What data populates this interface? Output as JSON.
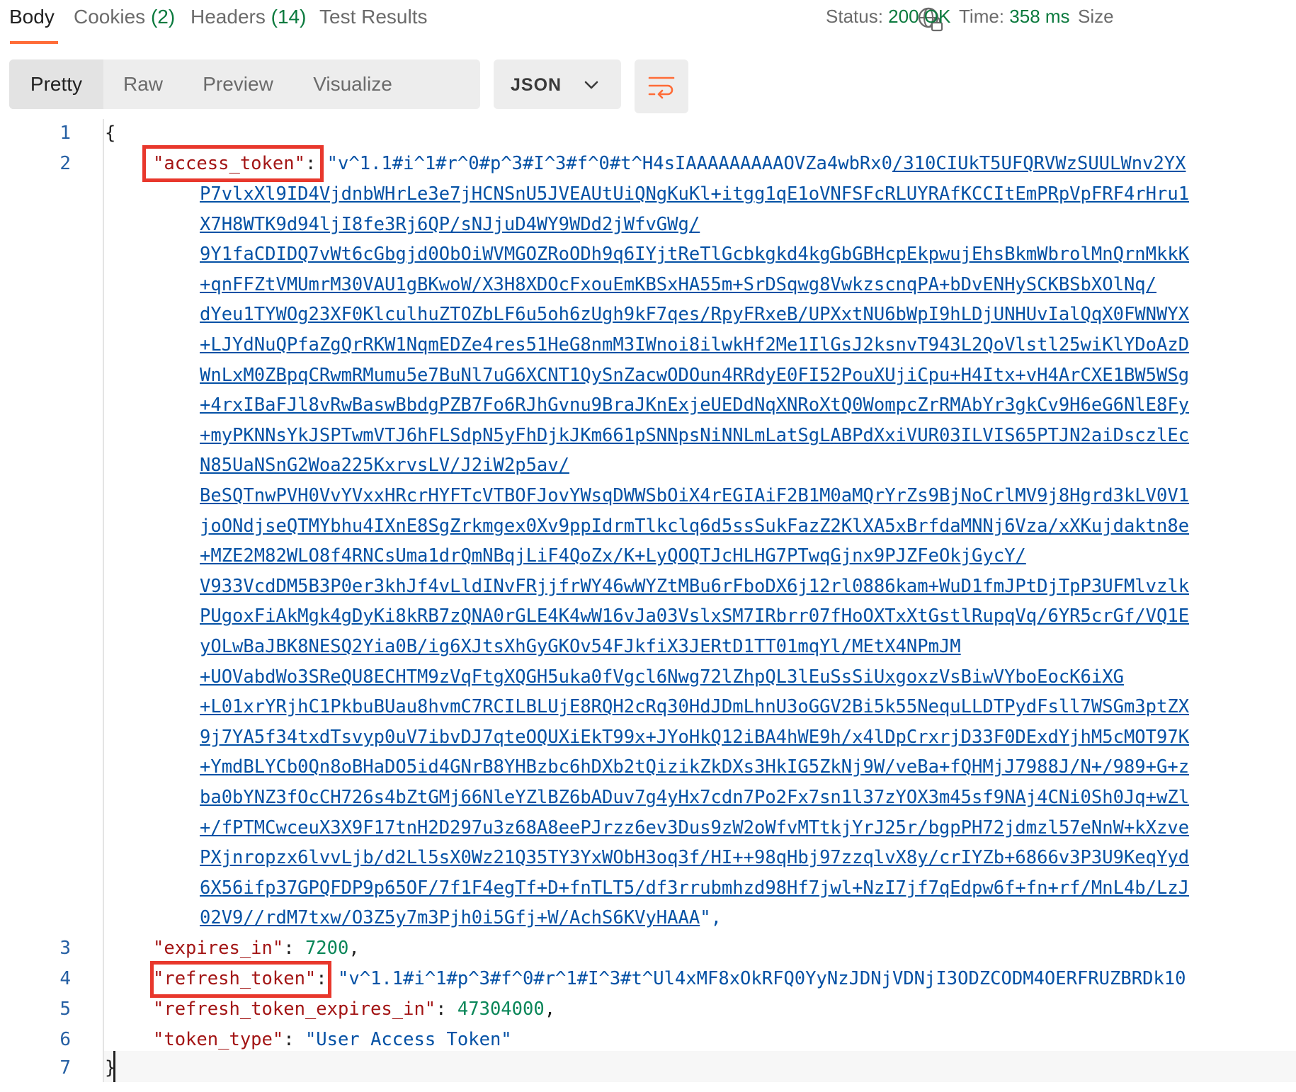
{
  "tabs": [
    {
      "label": "Body",
      "count": ""
    },
    {
      "label": "Cookies ",
      "count": "(2)"
    },
    {
      "label": "Headers ",
      "count": "(14)"
    },
    {
      "label": "Test Results",
      "count": ""
    }
  ],
  "status": {
    "status_label": "Status:",
    "status_value": "200 OK",
    "time_label": "Time:",
    "time_value": "358 ms",
    "size_label": "Size"
  },
  "view_modes": [
    "Pretty",
    "Raw",
    "Preview",
    "Visualize"
  ],
  "format": "JSON",
  "icons": {
    "globe": "globe-lock-icon",
    "wrap": "wrap-lines-icon",
    "chevron": "chevron-down-icon"
  },
  "colors": {
    "accent": "#ff6c37",
    "status_ok": "#0b7a3e",
    "highlight": "#e8372c"
  },
  "editor": {
    "line_numbers": [
      "1",
      "2",
      "3",
      "4",
      "5",
      "6",
      "7"
    ],
    "open_brace": "{",
    "close_brace": "}",
    "access_token_key": "\"access_token\"",
    "access_token_first": "\"v^1.1#i^1#r^0#p^3#I^3#f^0#t^H4sIAAAAAAAAAOVZa4wbRx0",
    "access_token_first_link": "/310CIUkT5UFQRVWzSUULWnv2YX",
    "access_token_cont": [
      "P7vlxXl9ID4VjdnbWHrLe3e7jHCNSnU5JVEAUtUiQNgKuKl+itgg1qE1oVNFSFcRLUYRAfKCCItEmPRpVpFRF4rHru1",
      "X7H8WTK9d94ljI8fe3Rj6QP/sNJjuD4WY9WDd2jWfvGWg/",
      "9Y1faCDIDQ7vWt6cGbgjd0ObOiWVMGOZRoODh9q6IYjtReTlGcbkgkd4kgGbGBHcpEkpwujEhsBkmWbrolMnQrnMkkK",
      "+qnFFZtVMUmrM30VAU1gBKwoW/X3H8XDOcFxouEmKBSxHA55m+SrDSqwg8VwkzscnqPA+bDvENHySCKBSbXOlNq/",
      "dYeu1TYWOg23XF0KlculhuZTOZbLF6u5oh6zUgh9kF7qes/RpyFRxeB/UPXxtNU6bWpI9hLDjUNHUvIalQqX0FWNWYX",
      "+LJYdNuQPfaZgQrRKW1NqmEDZe4res51HeG8nmM3IWnoi8ilwkHf2Me1IlGsJ2ksnvT943L2QoVlstl25wiKlYDoAzD",
      "WnLxM0ZBpqCRwmRMumu5e7BuNl7uG6XCNT1QySnZacwODOun4RRdyE0FI52PouXUjiCpu+H4Itx+vH4ArCXE1BW5WSg",
      "+4rxIBaFJl8vRwBaswBbdgPZB7Fo6RJhGvnu9BraJKnExjeUEDdNqXNRoXtQ0WompcZrRMAbYr3gkCv9H6eG6NlE8Fy",
      "+myPKNNsYkJSPTwmVTJ6hFLSdpN5yFhDjkJKm661pSNNpsNiNNLmLatSgLABPdXxiVUR03ILVIS65PTJN2aiDsczlEc",
      "N85UaNSnG2Woa225KxrvsLV/J2iW2p5av/",
      "BeSQTnwPVH0VvYVxxHRcrHYFTcVTBOFJovYWsqDWWSbOiX4rEGIAiF2B1M0aMQrYrZs9BjNoCrlMV9j8Hgrd3kLV0V1",
      "joONdjseQTMYbhu4IXnE8SgZrkmgex0Xv9ppIdrmTlkclq6d5ssSukFazZ2KlXA5xBrfdaMNNj6Vza/xXKujdaktn8e",
      "+MZE2M82WLO8f4RNCsUma1drQmNBqjLiF4QoZx/K+LyQOQTJcHLHG7PTwqGjnx9PJZFeOkjGycY/",
      "V933VcdDM5B3P0er3khJf4vLldINvFRjjfrWY46wWYZtMBu6rFboDX6j12rl0886kam+WuD1fmJPtDjTpP3UFMlvzlk",
      "PUgoxFiAkMgk4gDyKi8kRB7zQNA0rGLE4K4wW16vJa03VslxSM7IRbrr07fHoOXTxXtGstlRupqVq/6YR5crGf/VQ1E",
      "yOLwBaJBK8NESQ2Yia0B/ig6XJtsXhGyGKOv54FJkfiX3JERtD1TT01mqYl/MEtX4NPmJM",
      "+UOVabdWo3SReQU8ECHTM9zVqFtgXQGH5uka0fVgcl6Nwg72lZhpQL3lEuSsSiUxgoxzVsBiwVYboEocK6iXG",
      "+L01xrYRjhC1PkbuBUau8hvmC7RCILBLUjE8RQH2cRq30HdJDmLhnU3oGGV2Bi5k55NequLLDTPydFsll7WSGm3ptZX",
      "9j7YA5f34txdTsvyp0uV7ibvDJ7qteOQUXiEkT99x+JYoHkQ12iBA4hWE9h/x4lDpCrxrjD33F0DExdYjhM5cMOT97K",
      "+YmdBLYCb0Qn8oBHaDO5id4GNrB8YHBzbc6hDXb2tQizikZkDXs3HkIG5ZkNj9W/veBa+fQHMjJ7988J/N+/989+G+z",
      "ba0bYNZ3fOcCH726s4bZtGMj66NleYZlBZ6bADuv7g4yHx7cdn7Po2Fx7sn1l37zYOX3m45sf9NAj4CNi0Sh0Jq+wZl",
      "+/fPTMCwceuX3X9F17tnH2D297u3z68A8eePJrzz6ev3Dus9zW2oWfvMTtkjYrJ25r/bgpPH72jdmzl57eNnW+kXzve",
      "PXjnropzx6lvvLjb/d2Ll5sX0Wz21Q35TY3YxWObH3oq3f/HI++98qHbj97zzqlvX8y/crIYZb+6866v3P3U9KeqYyd",
      "6X56ifp37GPQFDP9p65OF/7f1F4egTf+D+fnTLT5/df3rrubmhzd98Hf7jwl+NzI7jf7qEdpw6f+fn+rf/MnL4b/LzJ"
    ],
    "access_token_last_link": "02V9//rdM7txw/O3Z5y7m3Pjh0i5Gfj+W/AchS6KVyHAAA",
    "access_token_last_tail": "\",",
    "expires_in_key": "\"expires_in\"",
    "expires_in_value": "7200",
    "refresh_token_key": "\"refresh_token\"",
    "refresh_token_value": "\"v^1.1#i^1#p^3#f^0#r^1#I^3#t^Ul4xMF8xOkRFQ0YyNzJDNjVDNjI3ODZCODM4OERFRUZBRDk10",
    "refresh_expires_key": "\"refresh_token_expires_in\"",
    "refresh_expires_value": "47304000",
    "token_type_key": "\"token_type\"",
    "token_type_value": "\"User Access Token\"",
    "colon": ": ",
    "comma": ","
  }
}
